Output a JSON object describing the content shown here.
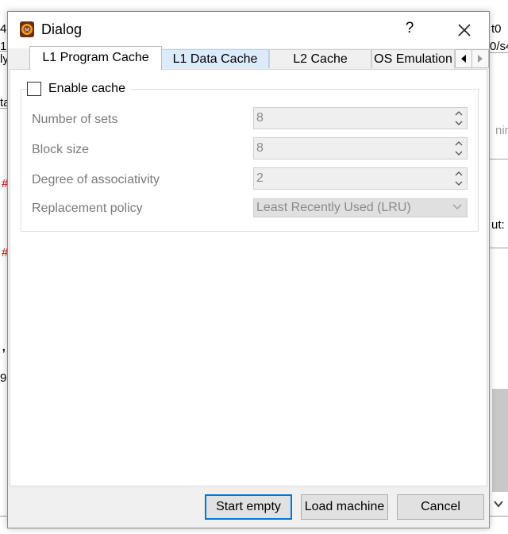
{
  "background": {
    "fragments": [
      "4,",
      "1(",
      "ly",
      "ta",
      "#",
      "#",
      ",",
      "9",
      "t0",
      "0/s4",
      "nin",
      "ut:"
    ]
  },
  "dialog": {
    "title": "Dialog",
    "help": "?",
    "tabs": [
      {
        "label": "L1 Program Cache"
      },
      {
        "label": "L1 Data Cache"
      },
      {
        "label": "L2 Cache"
      },
      {
        "label": "OS Emulation"
      }
    ],
    "enable_cache": {
      "label": "Enable cache",
      "checked": false
    },
    "fields": {
      "sets": {
        "label": "Number of sets",
        "value": "8"
      },
      "block": {
        "label": "Block size",
        "value": "8"
      },
      "assoc": {
        "label": "Degree of associativity",
        "value": "2"
      },
      "policy": {
        "label": "Replacement policy",
        "value": "Least Recently Used (LRU)"
      }
    },
    "buttons": {
      "start_empty": "Start empty",
      "load_machine": "Load machine",
      "cancel": "Cancel"
    }
  },
  "colors": {
    "default_button_border": "#0078d7",
    "inactive_tab": "#dcebfc"
  },
  "icons": [
    "app-icon",
    "close-icon",
    "scroll-left-icon",
    "scroll-right-icon",
    "spin-up-icon",
    "spin-down-icon",
    "chevron-down-icon"
  ]
}
